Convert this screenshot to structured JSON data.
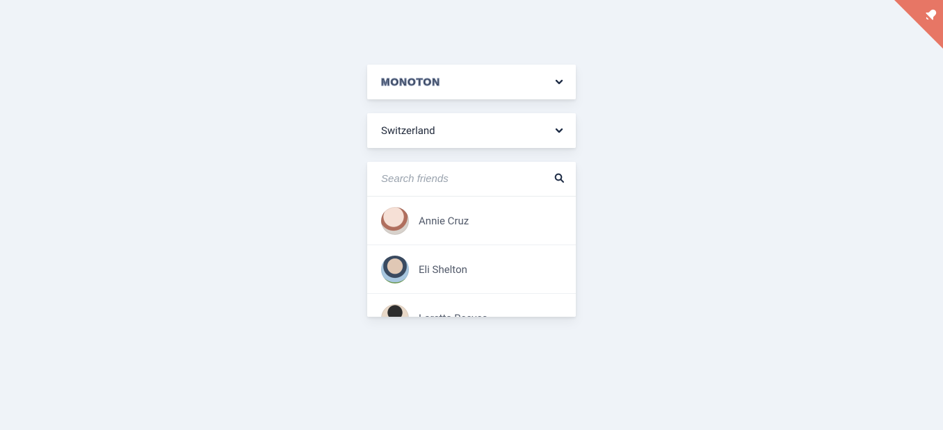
{
  "dropdowns": {
    "font": {
      "label": "Monoton"
    },
    "country": {
      "label": "Switzerland"
    }
  },
  "search": {
    "placeholder": "Search friends"
  },
  "friends": [
    {
      "name": "Annie Cruz"
    },
    {
      "name": "Eli Shelton"
    },
    {
      "name": "Loretta Reeves"
    }
  ]
}
